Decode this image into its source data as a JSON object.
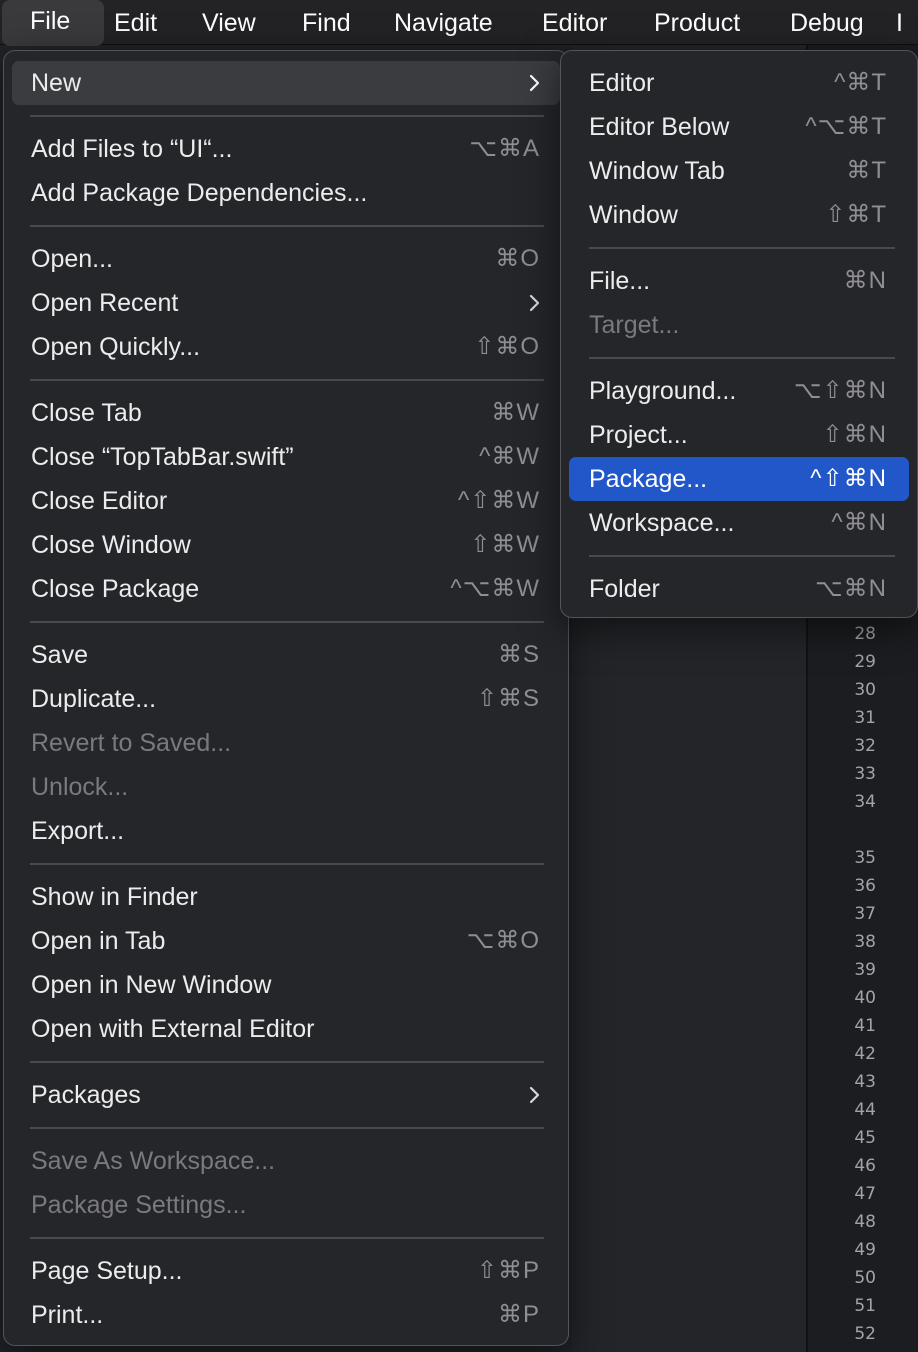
{
  "menubar": {
    "items": [
      "File",
      "Edit",
      "View",
      "Find",
      "Navigate",
      "Editor",
      "Product",
      "Debug",
      "I"
    ]
  },
  "file_menu": {
    "new": "New",
    "add_files": "Add Files to “UI“...",
    "add_files_sc": "⌥⌘A",
    "add_package_deps": "Add Package Dependencies...",
    "open": "Open...",
    "open_sc": "⌘O",
    "open_recent": "Open Recent",
    "open_quickly": "Open Quickly...",
    "open_quickly_sc": "⇧⌘O",
    "close_tab": "Close Tab",
    "close_tab_sc": "⌘W",
    "close_file": "Close “TopTabBar.swift”",
    "close_file_sc": "^⌘W",
    "close_editor": "Close Editor",
    "close_editor_sc": "^⇧⌘W",
    "close_window": "Close Window",
    "close_window_sc": "⇧⌘W",
    "close_package": "Close Package",
    "close_package_sc": "^⌥⌘W",
    "save": "Save",
    "save_sc": "⌘S",
    "duplicate": "Duplicate...",
    "duplicate_sc": "⇧⌘S",
    "revert": "Revert to Saved...",
    "unlock": "Unlock...",
    "export": "Export...",
    "show_in_finder": "Show in Finder",
    "open_in_tab": "Open in Tab",
    "open_in_tab_sc": "⌥⌘O",
    "open_new_window": "Open in New Window",
    "open_external": "Open with External Editor",
    "packages": "Packages",
    "save_as_workspace": "Save As Workspace...",
    "package_settings": "Package Settings...",
    "page_setup": "Page Setup...",
    "page_setup_sc": "⇧⌘P",
    "print": "Print...",
    "print_sc": "⌘P"
  },
  "new_submenu": {
    "editor": "Editor",
    "editor_sc": "^⌘T",
    "editor_below": "Editor Below",
    "editor_below_sc": "^⌥⌘T",
    "window_tab": "Window Tab",
    "window_tab_sc": "⌘T",
    "window": "Window",
    "window_sc": "⇧⌘T",
    "file": "File...",
    "file_sc": "⌘N",
    "target": "Target...",
    "playground": "Playground...",
    "playground_sc": "⌥⇧⌘N",
    "project": "Project...",
    "project_sc": "⇧⌘N",
    "package": "Package...",
    "package_sc": "^⇧⌘N",
    "workspace": "Workspace...",
    "workspace_sc": "^⌘N",
    "folder": "Folder",
    "folder_sc": "⌥⌘N"
  },
  "line_numbers": [
    "28",
    "29",
    "30",
    "31",
    "32",
    "33",
    "34",
    "35",
    "36",
    "37",
    "38",
    "39",
    "40",
    "41",
    "42",
    "43",
    "44",
    "45",
    "46",
    "47",
    "48",
    "49",
    "50",
    "51",
    "52"
  ],
  "colors": {
    "highlight": "#2f6bdc",
    "menu_bg": "#26272b",
    "disabled_text": "#7a7a7e"
  }
}
